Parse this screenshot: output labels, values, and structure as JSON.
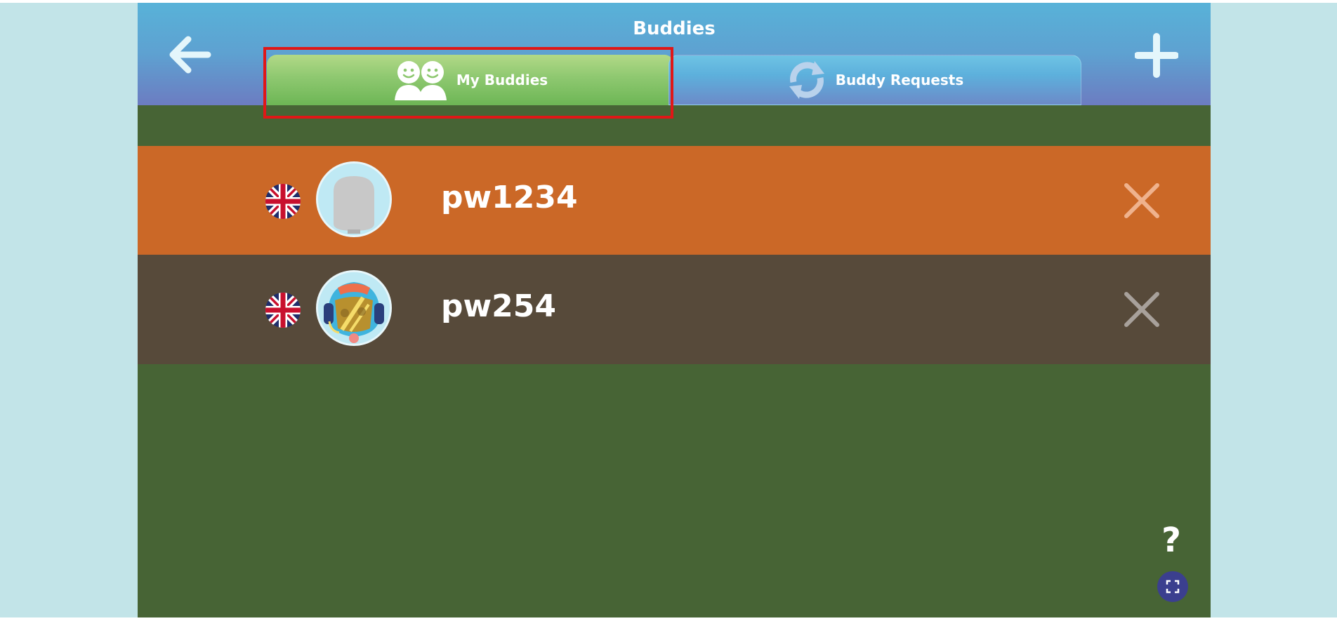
{
  "header": {
    "title": "Buddies",
    "back_icon": "arrow-left-icon",
    "add_icon": "plus-icon"
  },
  "tabs": [
    {
      "label": "My Buddies",
      "icon": "two-people-icon",
      "selected": true
    },
    {
      "label": "Buddy Requests",
      "icon": "refresh-arrows-icon",
      "selected": false
    }
  ],
  "buddies": [
    {
      "username": "pw1234",
      "flag": "uk-flag-icon",
      "avatar": "default-avatar-icon",
      "row_color": "#cb6827"
    },
    {
      "username": "pw254",
      "flag": "uk-flag-icon",
      "avatar": "helmet-avatar-icon",
      "row_color": "#574a3a"
    }
  ],
  "help": {
    "label": "?"
  },
  "colors": {
    "content_bg": "#476435",
    "page_bg": "#c2e4e8",
    "highlight": "#e01717",
    "tab_selected": "#8ec870",
    "tab_unselected": "#5db0dc"
  }
}
